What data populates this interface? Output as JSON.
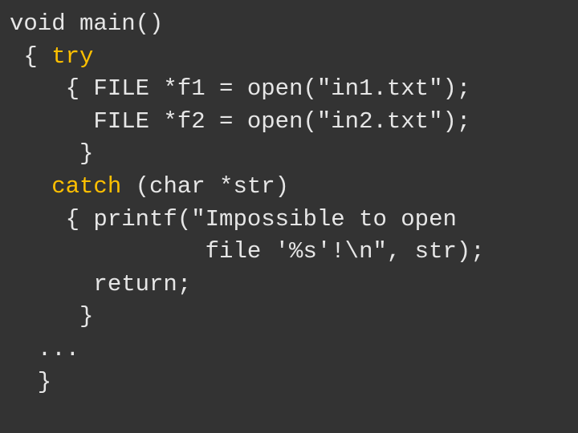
{
  "code": {
    "l1": "void main()",
    "l2a": " { ",
    "l2b": "try",
    "l3": "    { FILE *f1 = open(\"in1.txt\");",
    "l4": "      FILE *f2 = open(\"in2.txt\");",
    "l5": "     }",
    "l6a": "   ",
    "l6b": "catch",
    "l6c": " (char *str)",
    "l7": "    { printf(\"Impossible to open",
    "l8": "              file '%s'!\\n\", str);",
    "l9": "      return;",
    "l10": "     }",
    "l11": "  ...",
    "l12": "  }"
  }
}
